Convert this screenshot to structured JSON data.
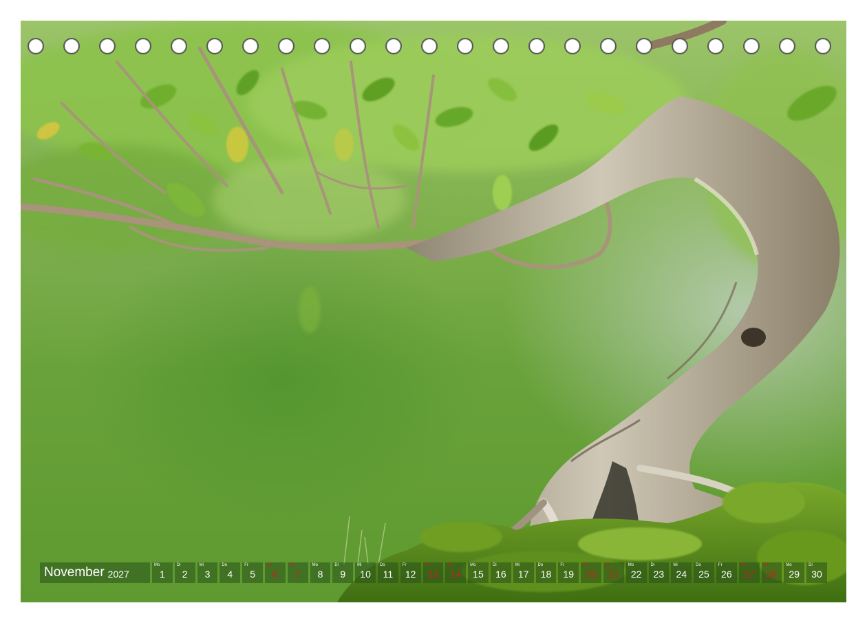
{
  "calendar": {
    "month": "November",
    "year": "2027",
    "days": [
      {
        "abbr": "Mo",
        "num": "1",
        "red": false
      },
      {
        "abbr": "Di",
        "num": "2",
        "red": false
      },
      {
        "abbr": "Mi",
        "num": "3",
        "red": false
      },
      {
        "abbr": "Do",
        "num": "4",
        "red": false
      },
      {
        "abbr": "Fr",
        "num": "5",
        "red": false
      },
      {
        "abbr": "Sa",
        "num": "6",
        "red": true
      },
      {
        "abbr": "So",
        "num": "7",
        "red": true
      },
      {
        "abbr": "Mo",
        "num": "8",
        "red": false
      },
      {
        "abbr": "Di",
        "num": "9",
        "red": false
      },
      {
        "abbr": "Mi",
        "num": "10",
        "red": false
      },
      {
        "abbr": "Do",
        "num": "11",
        "red": false
      },
      {
        "abbr": "Fr",
        "num": "12",
        "red": false
      },
      {
        "abbr": "Sa",
        "num": "13",
        "red": true
      },
      {
        "abbr": "So",
        "num": "14",
        "red": true
      },
      {
        "abbr": "Mo",
        "num": "15",
        "red": false
      },
      {
        "abbr": "Di",
        "num": "16",
        "red": false
      },
      {
        "abbr": "Mi",
        "num": "17",
        "red": false
      },
      {
        "abbr": "Do",
        "num": "18",
        "red": false
      },
      {
        "abbr": "Fr",
        "num": "19",
        "red": false
      },
      {
        "abbr": "Sa",
        "num": "20",
        "red": true
      },
      {
        "abbr": "So",
        "num": "21",
        "red": true
      },
      {
        "abbr": "Mo",
        "num": "22",
        "red": false
      },
      {
        "abbr": "Di",
        "num": "23",
        "red": false
      },
      {
        "abbr": "Mi",
        "num": "24",
        "red": false
      },
      {
        "abbr": "Do",
        "num": "25",
        "red": false
      },
      {
        "abbr": "Fr",
        "num": "26",
        "red": false
      },
      {
        "abbr": "Sa",
        "num": "27",
        "red": true
      },
      {
        "abbr": "So",
        "num": "28",
        "red": true
      },
      {
        "abbr": "Mo",
        "num": "29",
        "red": false
      },
      {
        "abbr": "Di",
        "num": "30",
        "red": false
      }
    ]
  },
  "binding": {
    "hole_count": 23
  },
  "colors": {
    "foliage": "#7fb04c",
    "bark": "#b7ad98",
    "moss": "#5e8f1e",
    "weekend_text": "#c8231c",
    "strip_bg": "#2d5a1c"
  }
}
